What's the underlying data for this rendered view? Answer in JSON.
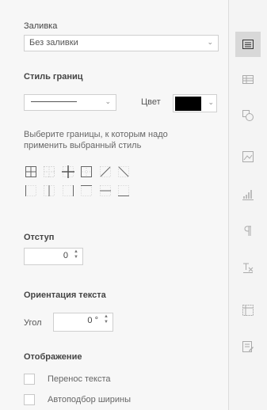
{
  "fill": {
    "title": "Заливка",
    "value": "Без заливки"
  },
  "border_style": {
    "title": "Стиль границ",
    "color_label": "Цвет",
    "color": "#000000",
    "description": [
      "Выберите границы, к которым надо",
      "применить выбранный стиль"
    ]
  },
  "border_buttons": [
    "border-all-icon",
    "border-inner-icon",
    "border-inner-cross-icon",
    "border-outer-icon",
    "border-diagonal-up-icon",
    "border-diagonal-down-icon",
    "border-left-icon",
    "border-inner-vertical-icon",
    "border-right-icon",
    "border-top-icon",
    "border-inner-horizontal-icon",
    "border-bottom-icon"
  ],
  "indent": {
    "title": "Отступ",
    "value": "0"
  },
  "orientation": {
    "title": "Ориентация текста",
    "angle_label": "Угол",
    "angle_value": "0 °"
  },
  "display": {
    "title": "Отображение",
    "wrap_label": "Перенос текста",
    "autofit_label": "Автоподбор ширины"
  },
  "sidebar_icons": [
    "cell-settings-icon",
    "table-settings-icon",
    "shape-settings-icon",
    "image-settings-icon",
    "chart-settings-icon",
    "paragraph-settings-icon",
    "text-art-settings-icon",
    "pivot-table-settings-icon",
    "signature-settings-icon"
  ],
  "active_sidebar_index": 0
}
